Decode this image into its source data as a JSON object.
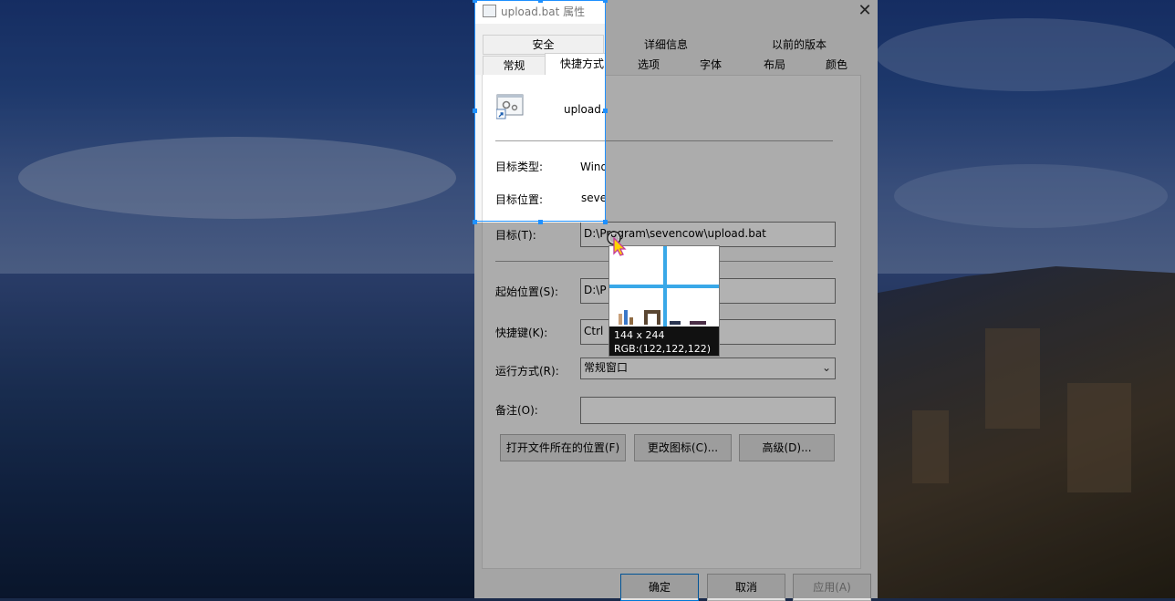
{
  "dialog": {
    "title": "upload.bat 属性",
    "tabs_row1": [
      "安全",
      "详细信息",
      "以前的版本"
    ],
    "tabs_row2": [
      "常规",
      "快捷方式",
      "选项",
      "字体",
      "布局",
      "颜色"
    ],
    "file_name": "upload.bat",
    "target_type_label": "目标类型:",
    "target_type_value": "Windows 批处理文件",
    "target_location_label": "目标位置:",
    "target_location_value": "sevencow",
    "target_label": "目标(T):",
    "target_value": "D:\\Program\\sevencow\\upload.bat",
    "start_in_label": "起始位置(S):",
    "start_in_value": "D:\\P",
    "shortcut_key_label": "快捷键(K):",
    "shortcut_key_value": "Ctrl",
    "run_label": "运行方式(R):",
    "run_value": "常规窗口",
    "comment_label": "备注(O):",
    "comment_value": "",
    "open_location_button": "打开文件所在的位置(F)",
    "change_icon_button": "更改图标(C)...",
    "advanced_button": "高级(D)...",
    "ok_button": "确定",
    "cancel_button": "取消",
    "apply_button": "应用(A)"
  },
  "magnifier": {
    "size_text": "144 x 244",
    "rgb_text": "RGB:(122,122,122)"
  },
  "colors": {
    "selection": "#1e90ff",
    "crosshair": "#39a8e8"
  }
}
